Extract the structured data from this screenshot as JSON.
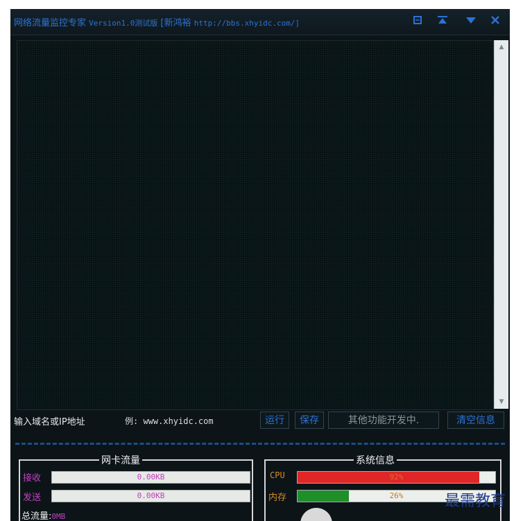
{
  "window": {
    "title_cn": "网络流量监控专家",
    "title_version": "Version1.0测试版",
    "title_author": "[新鸿裕",
    "title_url": "http://bbs.xhyidc.com/]",
    "buttons": [
      "menu-icon",
      "minimize-to-top-icon",
      "dropdown-icon",
      "close-icon"
    ],
    "accent_color": "#2c72d6"
  },
  "input": {
    "label": "输入域名或IP地址",
    "example": "例: www.xhyidc.com",
    "value": ""
  },
  "actions": {
    "run": "运行",
    "save": "保存",
    "other": "其他功能开发中.",
    "clear": "清空信息"
  },
  "nic_panel": {
    "title": "网卡流量",
    "receive_label": "接收",
    "receive_value": "0.00KB",
    "send_label": "发送",
    "send_value": "0.00KB",
    "total_label": "总流量:",
    "total_value": "0MB"
  },
  "sys_panel": {
    "title": "系统信息",
    "cpu_label": "CPU",
    "cpu_value": "92%",
    "cpu_percent": 92,
    "cpu_color": "#e02626",
    "mem_label": "内存",
    "mem_value": "26%",
    "mem_percent": 26,
    "mem_color": "#1f8f2a"
  },
  "watermark": "最需教育"
}
